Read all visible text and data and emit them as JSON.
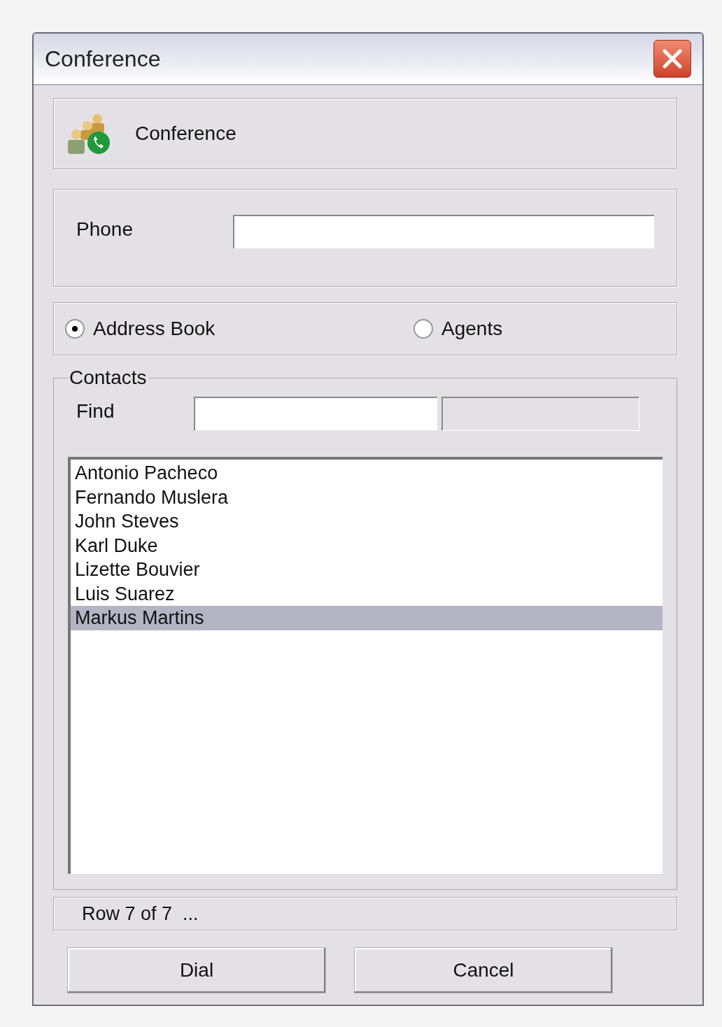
{
  "window": {
    "title": "Conference"
  },
  "header": {
    "title": "Conference"
  },
  "phone": {
    "label": "Phone"
  },
  "source_options": [
    {
      "label": "Address Book",
      "selected": true
    },
    {
      "label": "Agents",
      "selected": false
    }
  ],
  "contacts": {
    "legend": "Contacts",
    "find_label": "Find",
    "rows": [
      {
        "name": "Antonio Pacheco",
        "selected": false
      },
      {
        "name": "Fernando Muslera",
        "selected": false
      },
      {
        "name": "John Steves",
        "selected": false
      },
      {
        "name": "Karl Duke",
        "selected": false
      },
      {
        "name": "Lizette Bouvier",
        "selected": false
      },
      {
        "name": "Luis Suarez",
        "selected": false
      },
      {
        "name": "Markus Martins",
        "selected": true
      }
    ]
  },
  "status_bar": "Row 7 of 7  ...",
  "buttons": [
    "Dial",
    "Cancel"
  ]
}
